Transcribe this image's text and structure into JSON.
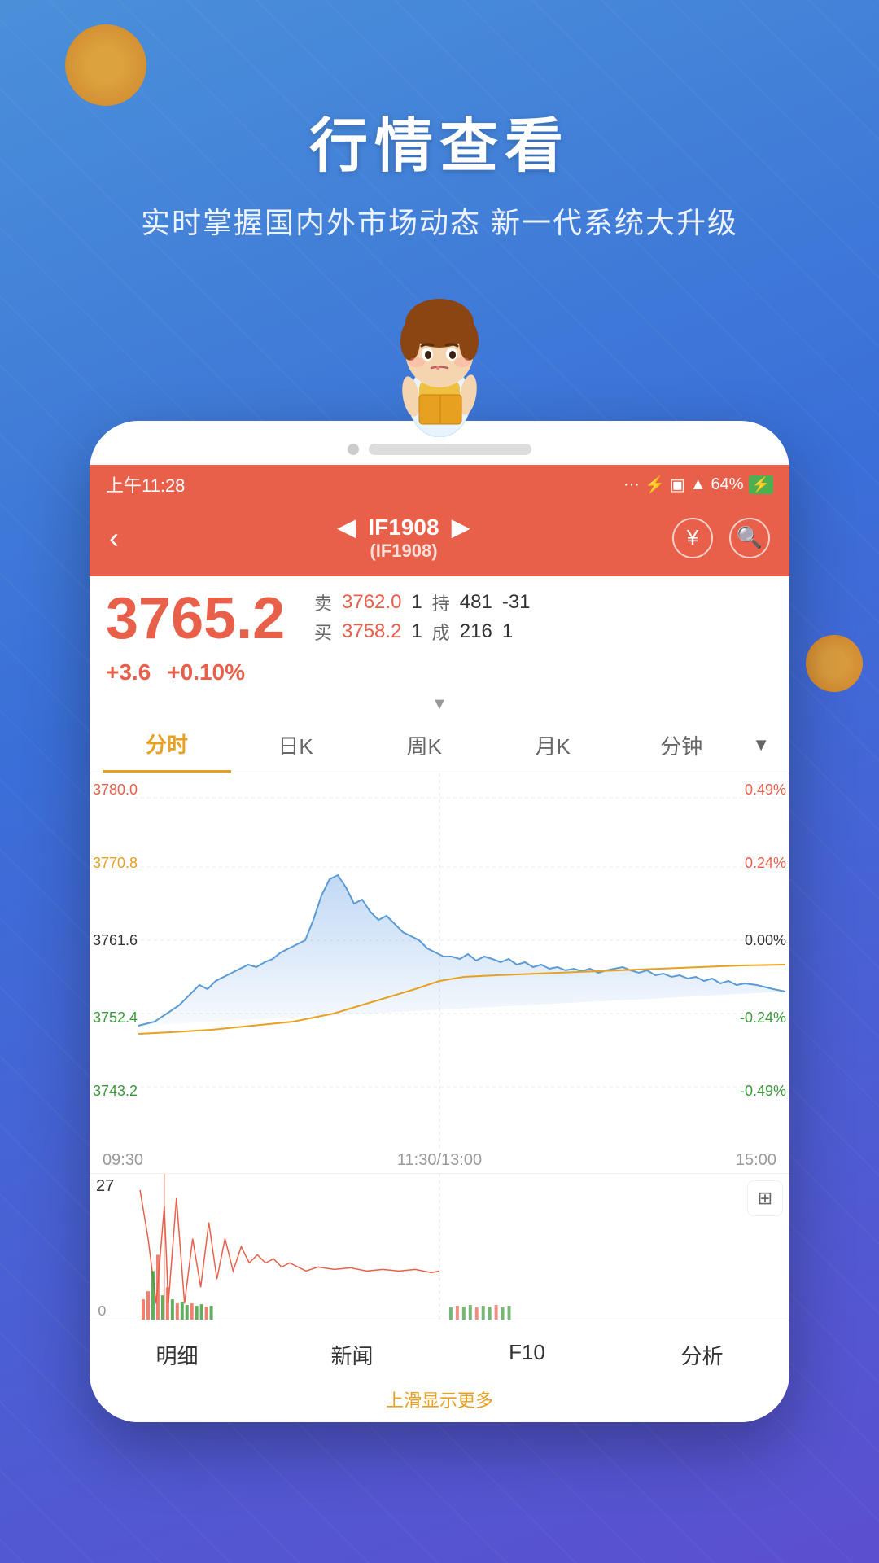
{
  "app": {
    "title": "行情查看",
    "subtitle": "实时掌握国内外市场动态 新一代系统大升级"
  },
  "status_bar": {
    "time": "上午11:28",
    "battery": "64%",
    "signal": "..."
  },
  "nav": {
    "back_label": "‹",
    "symbol": "IF1908",
    "symbol_sub": "(IF1908)",
    "left_arrow": "◀",
    "right_arrow": "▶"
  },
  "price": {
    "main": "3765.2",
    "sell_label": "卖",
    "sell_val": "3762.0",
    "sell_qty": "1",
    "hold_label": "持",
    "hold_val": "481",
    "hold_change": "-31",
    "buy_label": "买",
    "buy_val": "3758.2",
    "buy_qty": "1",
    "done_label": "成",
    "done_val": "216",
    "done_change": "1",
    "change_abs": "+3.6",
    "change_pct": "+0.10%"
  },
  "tabs": [
    {
      "label": "分时",
      "active": true
    },
    {
      "label": "日K",
      "active": false
    },
    {
      "label": "周K",
      "active": false
    },
    {
      "label": "月K",
      "active": false
    },
    {
      "label": "分钟",
      "active": false
    }
  ],
  "chart": {
    "y_labels_left": [
      "3780.0",
      "3770.8",
      "3761.6",
      "3752.4",
      "3743.2"
    ],
    "y_labels_right": [
      "0.49%",
      "0.24%",
      "0.00%",
      "-0.24%",
      "-0.49%"
    ],
    "x_labels": [
      "09:30",
      "11:30/13:00",
      "15:00"
    ],
    "volume_label": "27",
    "volume_zero": "0"
  },
  "bottom_nav": [
    {
      "label": "明细"
    },
    {
      "label": "新闻"
    },
    {
      "label": "F10"
    },
    {
      "label": "分析"
    }
  ],
  "swipe_hint": "上滑显示更多"
}
